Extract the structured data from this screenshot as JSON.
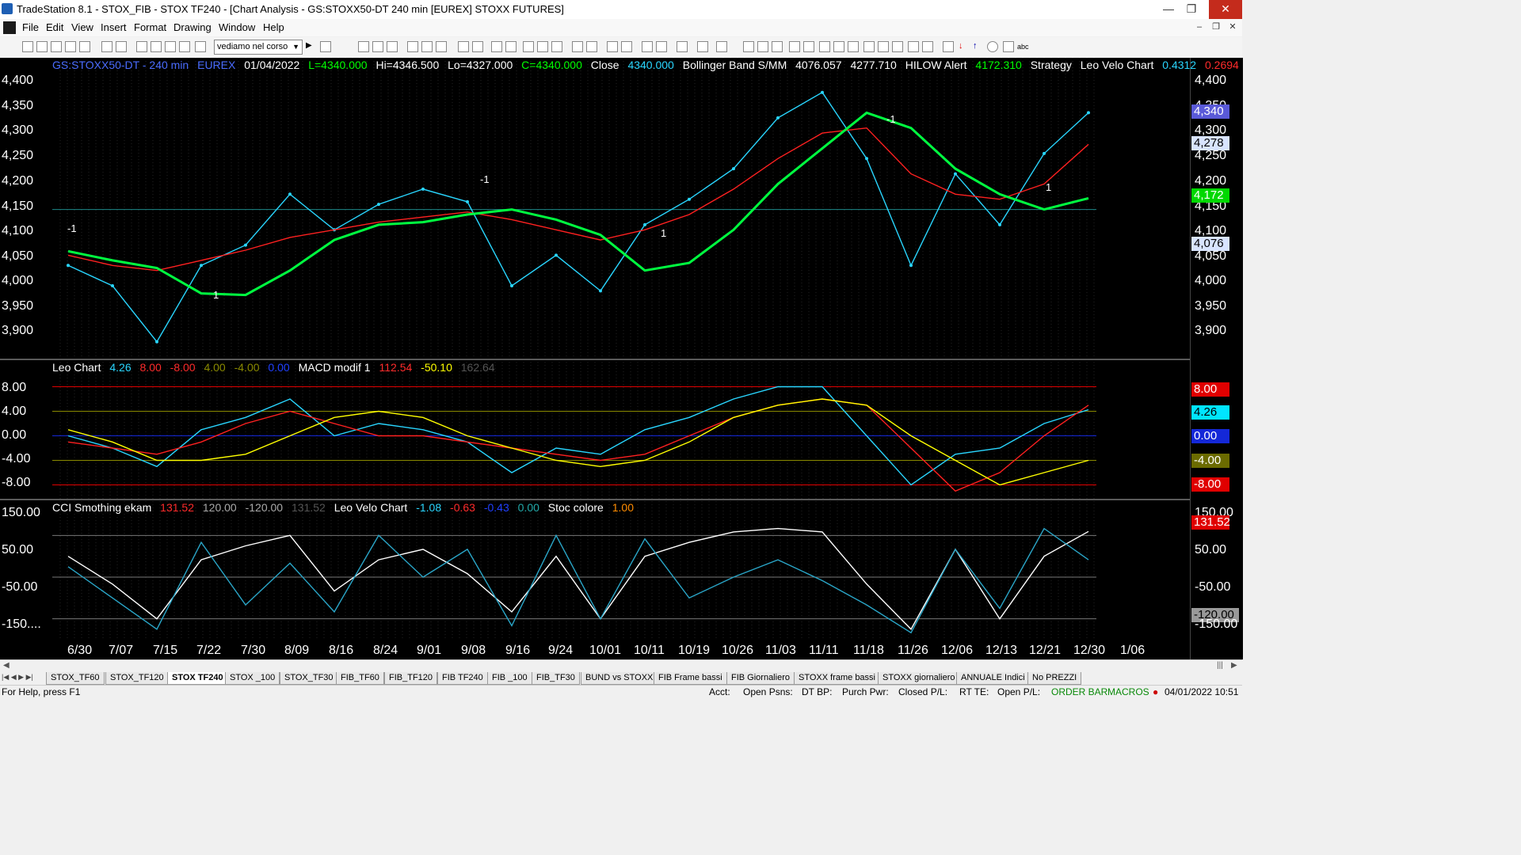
{
  "window": {
    "title": "TradeStation 8.1 - STOX_FIB - STOX TF240 - [Chart Analysis - GS:STOXX50-DT  240 min  [EUREX] STOXX FUTURES]",
    "controls": {
      "minimize": "—",
      "restore": "❐",
      "close": "✕"
    }
  },
  "menu": [
    "File",
    "Edit",
    "View",
    "Insert",
    "Format",
    "Drawing",
    "Window",
    "Help"
  ],
  "toolbar": {
    "dropdown_value": "vediamo nel corso"
  },
  "header_price": {
    "symbol": "GS:STOXX50-DT - 240 min",
    "exchange": "EUREX",
    "date": "01/04/2022",
    "low": "L=4340.000",
    "high": "Hi=4346.500",
    "lo": "Lo=4327.000",
    "close_c": "C=4340.000",
    "close_label": "Close",
    "close_val": "4340.000",
    "bb_label": "Bollinger Band S/MM",
    "bb_val1": "4076.057",
    "bb_val2": "4277.710",
    "hilow_label": "HILOW Alert",
    "hilow_val": "4172.310",
    "strategy": "Strategy",
    "leo_label": "Leo Velo Chart",
    "leo_val1": "0.4312",
    "leo_val2": "0.2694",
    "colors": {
      "symbol": "#4a6cff",
      "high_low": "#00ff00",
      "text": "#ffffff",
      "red": "#ff2b2b",
      "cyan": "#29d6ff"
    }
  },
  "header_leo": {
    "label": "Leo Chart",
    "v1": "4.26",
    "v2": "8.00",
    "v3": "-8.00",
    "v4": "4.00",
    "v5": "-4.00",
    "v6": "0.00",
    "macd_label": "MACD modif 1",
    "m1": "112.54",
    "m2": "-50.10",
    "m3": "162.64"
  },
  "header_cci": {
    "label": "CCI Smothing ekam",
    "c1": "131.52",
    "c2": "120.00",
    "c3": "-120.00",
    "c4": "131.52",
    "velo_label": "Leo Velo Chart",
    "v1": "-1.08",
    "v2": "-0.63",
    "v3": "-0.43",
    "v4": "0.00",
    "stoc_label": "Stoc colore",
    "stoc_val": "1.00"
  },
  "price_axis": [
    "4,400",
    "4,350",
    "4,300",
    "4,250",
    "4,200",
    "4,150",
    "4,100",
    "4,050",
    "4,000",
    "3,950",
    "3,900"
  ],
  "price_tags": {
    "t1": "4,340",
    "t2": "4,278",
    "t3": "4,172",
    "t4": "4,076"
  },
  "leo_axis": [
    "8.00",
    "4.00",
    "0.00",
    "-4.00",
    "-8.00"
  ],
  "leo_tags": {
    "t1": "8.00",
    "t2": "4.26",
    "t3": "0.00",
    "t4": "-4.00",
    "t5": "-8.00"
  },
  "cci_axis": [
    "150.00",
    "50.00",
    "-50.00",
    "-150...."
  ],
  "cci_tags": {
    "t1": "150.00",
    "t2": "131.52",
    "t3": "50.00",
    "t4": "-50.00",
    "t5": "-120.00",
    "t6": "-150.00"
  },
  "signal_labels": {
    "s1": "-1",
    "s2": "1",
    "s3": "-1",
    "s4": "1",
    "s5": "-1",
    "s6": "1"
  },
  "x_axis": [
    "6/30",
    "7/07",
    "7/15",
    "7/22",
    "7/30",
    "8/09",
    "8/16",
    "8/24",
    "9/01",
    "9/08",
    "9/16",
    "9/24",
    "10/01",
    "10/11",
    "10/19",
    "10/26",
    "11/03",
    "11/11",
    "11/18",
    "11/26",
    "12/06",
    "12/13",
    "12/21",
    "12/30",
    "1/06"
  ],
  "tabs": [
    "STOX_TF60",
    "STOX_TF120",
    "STOX TF240",
    "STOX _100",
    "STOX_TF30",
    "FIB_TF60",
    "FIB_TF120",
    "FIB TF240",
    "FIB _100",
    "FIB_TF30",
    "BUND vs STOXX",
    "FIB Frame bassi",
    "FIB Giornaliero",
    "STOXX frame bassi",
    "STOXX giornaliero",
    "ANNUALE Indici",
    "No PREZZI"
  ],
  "active_tab": "STOX TF240",
  "status": {
    "help": "For Help, press F1",
    "acct": "Acct:",
    "open_psns": "Open Psns:",
    "dt_bp": "DT BP:",
    "purch_pwr": "Purch Pwr:",
    "closed_pl": "Closed P/L:",
    "rt_te": "RT TE:",
    "open_pl": "Open P/L:",
    "order_bar": "ORDER BAR",
    "macros": "MACROS",
    "datetime": "04/01/2022 10:51"
  },
  "chart_data": [
    {
      "type": "line",
      "title": "GS:STOXX50-DT - 240 min",
      "x": [
        "6/30",
        "7/07",
        "7/15",
        "7/22",
        "7/30",
        "8/09",
        "8/16",
        "8/24",
        "9/01",
        "9/08",
        "9/16",
        "9/24",
        "10/01",
        "10/11",
        "10/19",
        "10/26",
        "11/03",
        "11/11",
        "11/18",
        "11/26",
        "12/06",
        "12/13",
        "12/21",
        "12/30"
      ],
      "ylim": [
        3860,
        4420
      ],
      "series": [
        {
          "name": "Close",
          "values": [
            4040,
            4000,
            3890,
            4040,
            4080,
            4180,
            4110,
            4160,
            4190,
            4165,
            4000,
            4060,
            3990,
            4120,
            4170,
            4230,
            4330,
            4380,
            4250,
            4040,
            4220,
            4120,
            4260,
            4340
          ]
        },
        {
          "name": "Bollinger Band S/MM",
          "values": [
            4060,
            4040,
            4030,
            4050,
            4070,
            4095,
            4110,
            4125,
            4135,
            4145,
            4130,
            4110,
            4090,
            4110,
            4140,
            4190,
            4250,
            4300,
            4310,
            4220,
            4180,
            4170,
            4200,
            4278
          ]
        },
        {
          "name": "HILOW Alert",
          "values": [
            4068,
            4050,
            4035,
            3985,
            3982,
            4030,
            4090,
            4120,
            4125,
            4140,
            4150,
            4130,
            4100,
            4030,
            4045,
            4110,
            4200,
            4270,
            4340,
            4310,
            4230,
            4180,
            4150,
            4172
          ]
        }
      ]
    },
    {
      "type": "line",
      "title": "Leo Chart",
      "x": [
        "6/30",
        "7/07",
        "7/15",
        "7/22",
        "7/30",
        "8/09",
        "8/16",
        "8/24",
        "9/01",
        "9/08",
        "9/16",
        "9/24",
        "10/01",
        "10/11",
        "10/19",
        "10/26",
        "11/03",
        "11/11",
        "11/18",
        "11/26",
        "12/06",
        "12/13",
        "12/21",
        "12/30"
      ],
      "ylim": [
        -10,
        10
      ],
      "series": [
        {
          "name": "Leo Chart",
          "values": [
            0,
            -2,
            -5,
            1,
            3,
            6,
            0,
            2,
            1,
            -1,
            -6,
            -2,
            -3,
            1,
            3,
            6,
            8,
            8,
            0,
            -8,
            -3,
            -2,
            2,
            4.26
          ]
        },
        {
          "name": "MACD modif 1",
          "values": [
            -1,
            -2,
            -3,
            -1,
            2,
            4,
            2,
            0,
            0,
            -1,
            -2,
            -3,
            -4,
            -3,
            0,
            3,
            5,
            6,
            5,
            -2,
            -9,
            -6,
            0,
            5
          ]
        },
        {
          "name": "Signal",
          "values": [
            1,
            -1,
            -4,
            -4,
            -3,
            0,
            3,
            4,
            3,
            0,
            -2,
            -4,
            -5,
            -4,
            -1,
            3,
            5,
            6,
            5,
            0,
            -4,
            -8,
            -6,
            -4
          ]
        }
      ]
    },
    {
      "type": "line",
      "title": "CCI Smothing ekam",
      "x": [
        "6/30",
        "7/07",
        "7/15",
        "7/22",
        "7/30",
        "8/09",
        "8/16",
        "8/24",
        "9/01",
        "9/08",
        "9/16",
        "9/24",
        "10/01",
        "10/11",
        "10/19",
        "10/26",
        "11/03",
        "11/11",
        "11/18",
        "11/26",
        "12/06",
        "12/13",
        "12/21",
        "12/30"
      ],
      "ylim": [
        -180,
        180
      ],
      "series": [
        {
          "name": "CCI Smothing ekam",
          "values": [
            60,
            -20,
            -120,
            50,
            90,
            120,
            -40,
            50,
            80,
            10,
            -100,
            60,
            -120,
            60,
            100,
            130,
            140,
            130,
            -20,
            -150,
            80,
            -120,
            60,
            131.52
          ]
        },
        {
          "name": "Leo Velo Chart",
          "values": [
            30,
            -60,
            -150,
            100,
            -80,
            40,
            -100,
            120,
            0,
            80,
            -140,
            120,
            -120,
            110,
            -60,
            0,
            50,
            -10,
            -80,
            -160,
            80,
            -90,
            140,
            50
          ]
        }
      ]
    }
  ]
}
